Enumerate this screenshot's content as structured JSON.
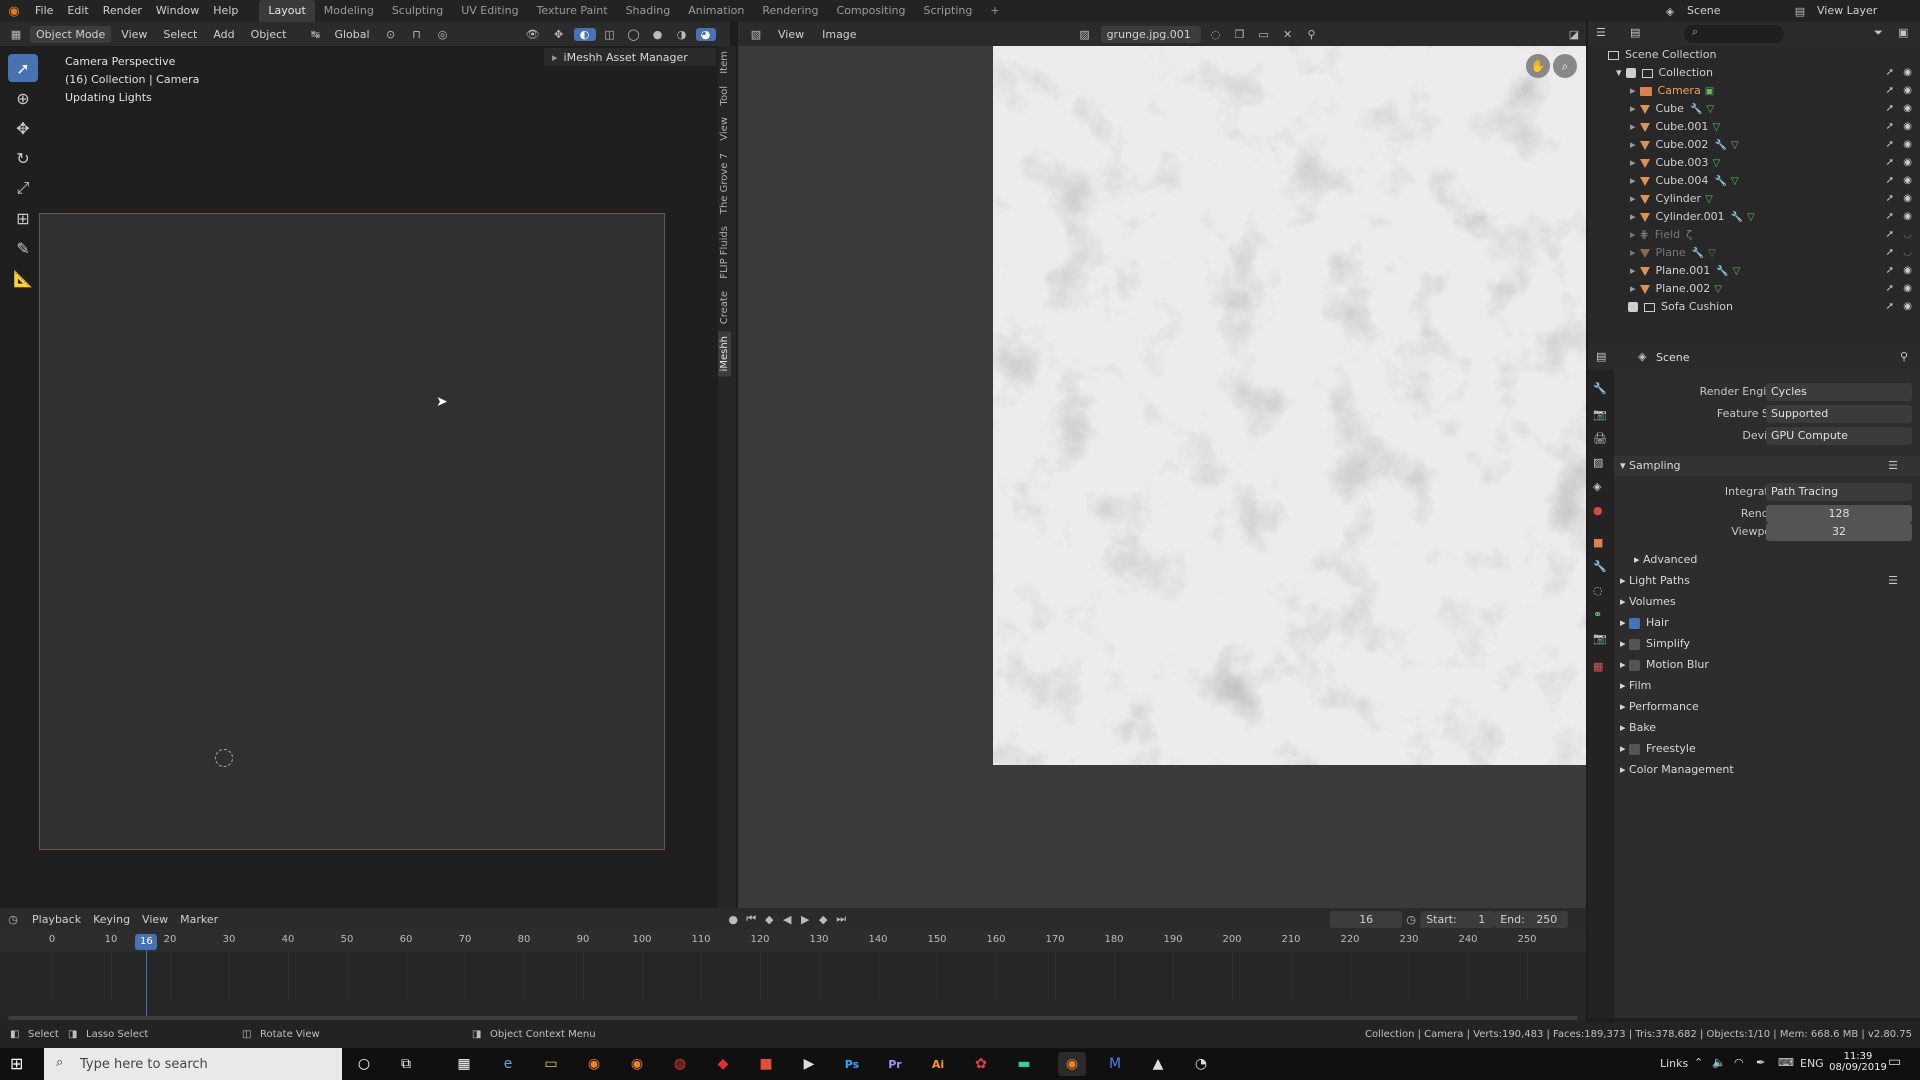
{
  "topbar": {
    "menus": [
      "File",
      "Edit",
      "Render",
      "Window",
      "Help"
    ],
    "workspaces": [
      "Layout",
      "Modeling",
      "Sculpting",
      "UV Editing",
      "Texture Paint",
      "Shading",
      "Animation",
      "Rendering",
      "Compositing",
      "Scripting"
    ],
    "add_tab": "+",
    "scene": "Scene",
    "view_layer": "View Layer"
  },
  "viewport": {
    "mode": "Object Mode",
    "menus": [
      "View",
      "Select",
      "Add",
      "Object"
    ],
    "orientation": "Global",
    "info": [
      "Camera Perspective",
      "(16) Collection | Camera",
      "Updating Lights"
    ],
    "npanel_tabs": [
      "Item",
      "Tool",
      "View",
      "The Grove 7",
      "FLIP Fluids",
      "Create",
      "iMeshh"
    ],
    "asset_manager": "iMeshh Asset Manager"
  },
  "image_editor": {
    "menus": [
      "View",
      "Image"
    ],
    "image_name": "grunge.jpg.001"
  },
  "outliner": {
    "root": "Scene Collection",
    "rows": [
      {
        "label": "Collection",
        "kind": "collection"
      },
      {
        "label": "Camera",
        "kind": "camera",
        "selected": true
      },
      {
        "label": "Cube",
        "kind": "mesh"
      },
      {
        "label": "Cube.001",
        "kind": "mesh"
      },
      {
        "label": "Cube.002",
        "kind": "mesh"
      },
      {
        "label": "Cube.003",
        "kind": "mesh"
      },
      {
        "label": "Cube.004",
        "kind": "mesh"
      },
      {
        "label": "Cylinder",
        "kind": "mesh"
      },
      {
        "label": "Cylinder.001",
        "kind": "mesh"
      },
      {
        "label": "Field",
        "kind": "field",
        "dim": true
      },
      {
        "label": "Plane",
        "kind": "mesh",
        "dim": true
      },
      {
        "label": "Plane.001",
        "kind": "mesh"
      },
      {
        "label": "Plane.002",
        "kind": "mesh"
      },
      {
        "label": "Sofa Cushion",
        "kind": "collection"
      }
    ]
  },
  "properties": {
    "context": "Scene",
    "render_engine_label": "Render Engine",
    "render_engine": "Cycles",
    "feature_set_label": "Feature Set",
    "feature_set": "Supported",
    "device_label": "Device",
    "device": "GPU Compute",
    "sampling": "Sampling",
    "integrator_label": "Integrator",
    "integrator": "Path Tracing",
    "render_label": "Render",
    "render_samples": "128",
    "viewport_label": "Viewport",
    "viewport_samples": "32",
    "advanced": "Advanced",
    "sections": [
      {
        "label": "Light Paths",
        "check": null
      },
      {
        "label": "Volumes",
        "check": null
      },
      {
        "label": "Hair",
        "check": true
      },
      {
        "label": "Simplify",
        "check": false
      },
      {
        "label": "Motion Blur",
        "check": false
      },
      {
        "label": "Film",
        "check": null
      },
      {
        "label": "Performance",
        "check": null
      },
      {
        "label": "Bake",
        "check": null
      },
      {
        "label": "Freestyle",
        "check": false
      },
      {
        "label": "Color Management",
        "check": null
      }
    ]
  },
  "timeline": {
    "menus": [
      "Playback",
      "Keying",
      "View",
      "Marker"
    ],
    "current_frame": "16",
    "start_label": "Start:",
    "start": "1",
    "end_label": "End:",
    "end": "250",
    "ticks": [
      "0",
      "10",
      "20",
      "30",
      "40",
      "50",
      "60",
      "70",
      "80",
      "90",
      "100",
      "110",
      "120",
      "130",
      "140",
      "150",
      "160",
      "170",
      "180",
      "190",
      "200",
      "210",
      "220",
      "230",
      "240",
      "250"
    ]
  },
  "statusbar": {
    "select": "Select",
    "lasso": "Lasso Select",
    "rotate": "Rotate View",
    "context_menu": "Object Context Menu",
    "stats": "Collection | Camera | Verts:190,483 | Faces:189,373 | Tris:378,682 | Objects:1/10 | Mem: 668.6 MB | v2.80.75"
  },
  "taskbar": {
    "search_placeholder": "Type here to search",
    "links": "Links",
    "lang": "ENG",
    "time": "11:39",
    "date": "08/09/2019"
  }
}
